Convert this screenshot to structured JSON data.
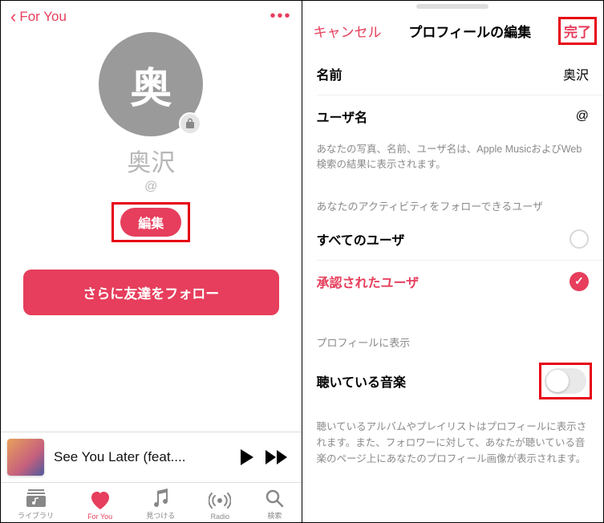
{
  "left": {
    "back_label": "For You",
    "avatar_initial": "奥",
    "profile_name": "奥沢",
    "profile_handle": "@",
    "edit_label": "編集",
    "follow_more_label": "さらに友達をフォロー",
    "now_playing_title": "See You Later (feat....",
    "tabs": {
      "library": "ライブラリ",
      "for_you": "For You",
      "browse": "見つける",
      "radio": "Radio",
      "search": "検索"
    }
  },
  "right": {
    "cancel": "キャンセル",
    "title": "プロフィールの編集",
    "done": "完了",
    "name_label": "名前",
    "name_value": "奥沢",
    "username_label": "ユーザ名",
    "username_value": "@",
    "privacy_hint": "あなたの写真、名前、ユーザ名は、Apple MusicおよびWeb検索の結果に表示されます。",
    "follower_section": "あなたのアクティビティをフォローできるユーザ",
    "option_all": "すべてのユーザ",
    "option_approved": "承認されたユーザ",
    "show_on_profile": "プロフィールに表示",
    "listening_label": "聴いている音楽",
    "footnote": "聴いているアルバムやプレイリストはプロフィールに表示されます。また、フォロワーに対して、あなたが聴いている音楽のページ上にあなたのプロフィール画像が表示されます。"
  }
}
